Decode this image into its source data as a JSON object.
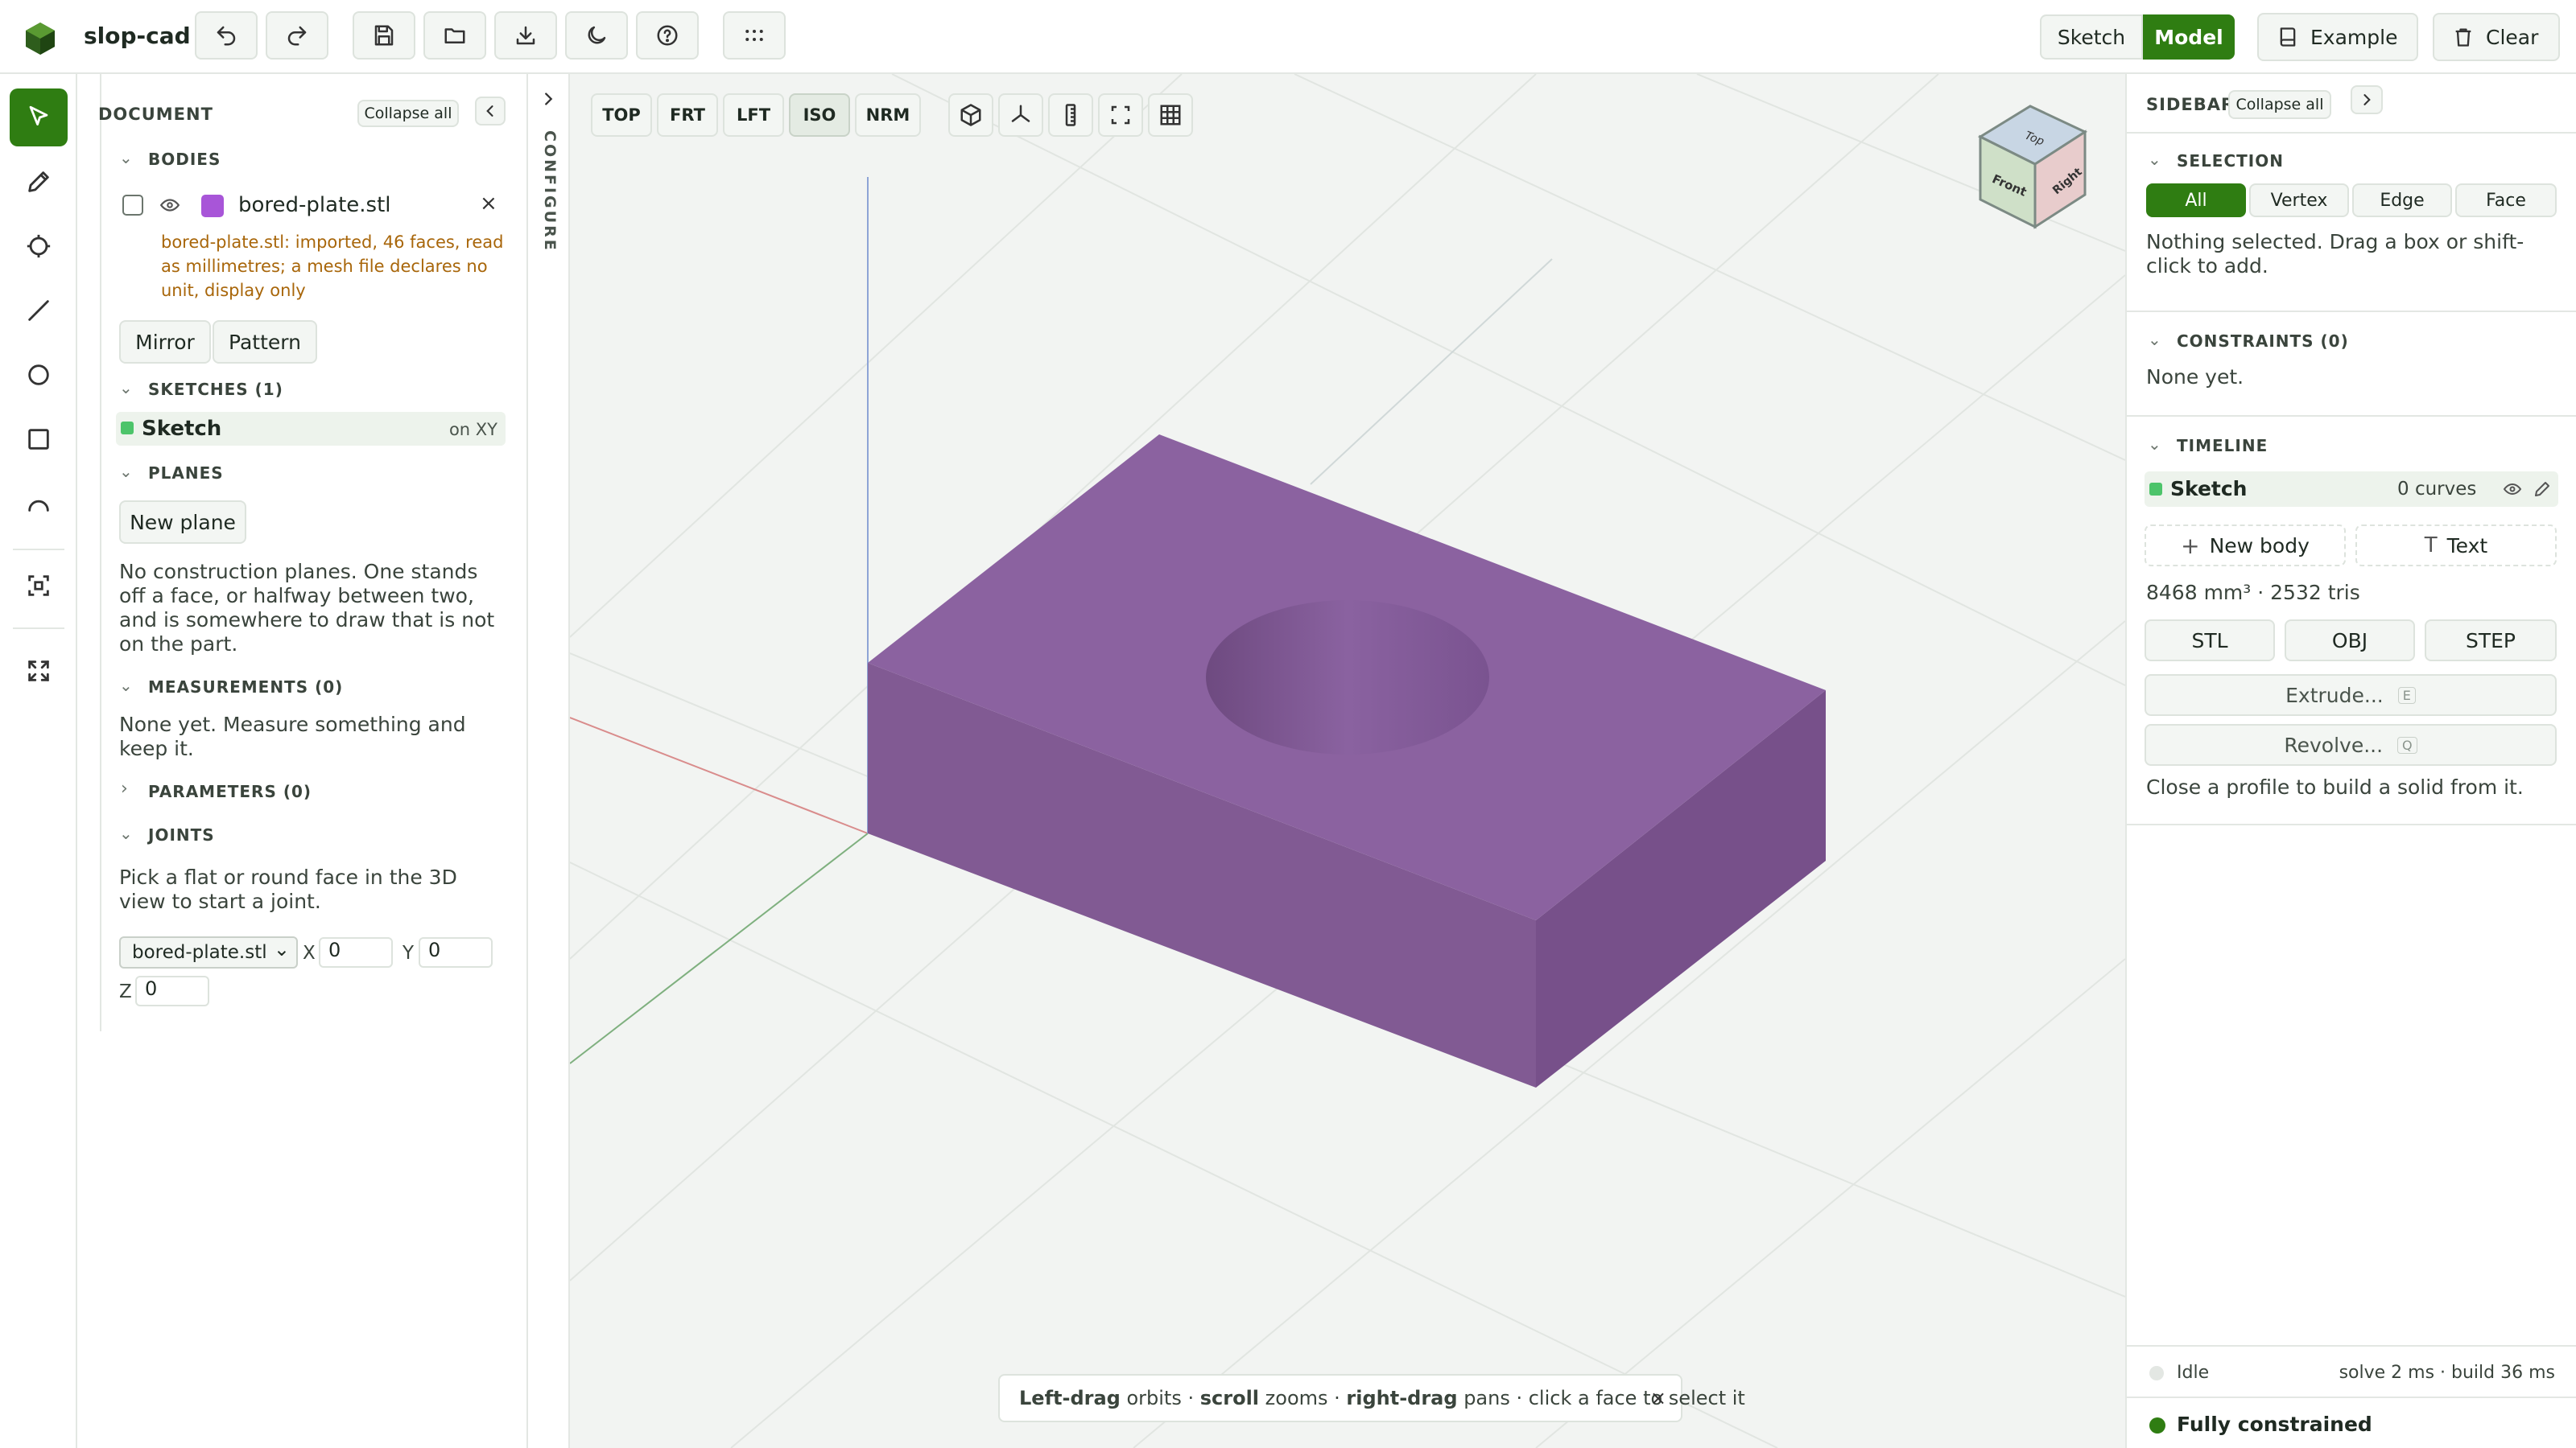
{
  "app": {
    "title": "slop-cad"
  },
  "modes": {
    "sketch": "Sketch",
    "model": "Model"
  },
  "topright": {
    "example": "Example",
    "clear": "Clear"
  },
  "document": {
    "title": "DOCUMENT",
    "collapse_all": "Collapse all",
    "bodies": {
      "title": "BODIES",
      "item_name": "bored-plate.stl",
      "item_color": "#a855d8",
      "warning": "bored-plate.stl: imported, 46 faces, read as millimetres; a mesh file declares no unit, display only",
      "mirror": "Mirror",
      "pattern": "Pattern"
    },
    "sketches": {
      "title": "SKETCHES (1)",
      "item": "Sketch",
      "item_meta": "on XY"
    },
    "planes": {
      "title": "PLANES",
      "new_plane": "New plane",
      "empty": "No construction planes. One stands off a face, or halfway between two, and is somewhere to draw that is not on the part."
    },
    "measurements": {
      "title": "MEASUREMENTS (0)",
      "empty": "None yet. Measure something and keep it."
    },
    "parameters": {
      "title": "PARAMETERS (0)"
    },
    "joints": {
      "title": "JOINTS",
      "hint": "Pick a flat or round face in the 3D view to start a joint.",
      "body_select": "bored-plate.stl",
      "x_label": "X",
      "x_value": "0",
      "y_label": "Y",
      "y_value": "0",
      "z_label": "Z",
      "z_value": "0"
    }
  },
  "configure": {
    "label": "CONFIGURE"
  },
  "viewport": {
    "views": {
      "top": "TOP",
      "front": "FRT",
      "left": "LFT",
      "iso": "ISO",
      "normal": "NRM"
    },
    "cube": {
      "top": "Top",
      "front": "Front",
      "right": "Right"
    },
    "hint": {
      "b1": "Left-drag",
      "t1": " orbits · ",
      "b2": "scroll",
      "t2": " zooms · ",
      "b3": "right-drag",
      "t3": " pans · click a face to select it"
    },
    "body_color": "#8b62a0"
  },
  "sidebar": {
    "title": "SIDEBAR",
    "collapse_all": "Collapse all",
    "selection": {
      "title": "SELECTION",
      "filters": [
        "All",
        "Vertex",
        "Edge",
        "Face"
      ],
      "hint": "Nothing selected. Drag a box or shift-click to add."
    },
    "constraints": {
      "title": "CONSTRAINTS (0)",
      "empty": "None yet."
    },
    "timeline": {
      "title": "TIMELINE",
      "item": "Sketch",
      "item_meta": "0 curves",
      "new_body": "New body",
      "text": "Text",
      "stats": "8468 mm³ · 2532 tris",
      "exports": [
        "STL",
        "OBJ",
        "STEP"
      ],
      "extrude": "Extrude...",
      "extrude_key": "E",
      "revolve": "Revolve...",
      "revolve_key": "Q",
      "hint": "Close a profile to build a solid from it."
    },
    "status": {
      "idle": "Idle",
      "timing": "solve 2 ms · build 36 ms",
      "constrained": "Fully constrained"
    }
  },
  "colors": {
    "accent": "#2f7d12",
    "sketch_dot": "#4cc46a",
    "warning": "#a8660a"
  }
}
